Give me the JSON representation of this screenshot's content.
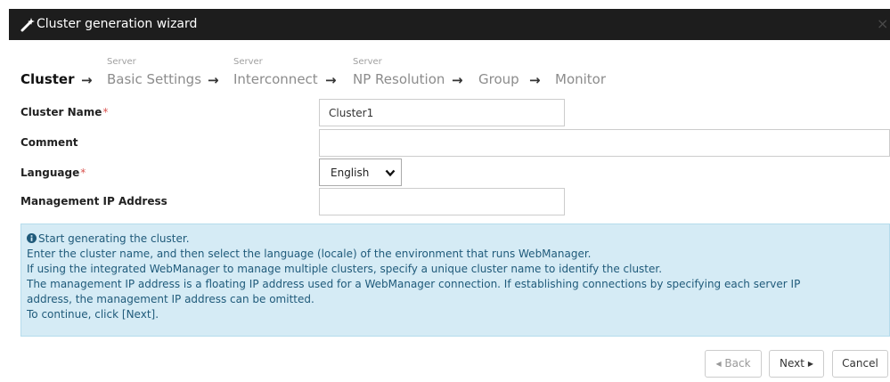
{
  "window": {
    "title": "Cluster generation wizard",
    "close_glyph": "×",
    "icon": "wand-icon"
  },
  "steps": [
    {
      "sub": "",
      "label": "Cluster",
      "active": true
    },
    {
      "sub": "Server",
      "label": "Basic Settings"
    },
    {
      "sub": "Server",
      "label": "Interconnect"
    },
    {
      "sub": "Server",
      "label": "NP Resolution"
    },
    {
      "sub": "",
      "label": "Group"
    },
    {
      "sub": "",
      "label": "Monitor"
    }
  ],
  "step_arrow": "→",
  "form": {
    "cluster_name": {
      "label": "Cluster Name",
      "required_mark": "*",
      "value": "Cluster1"
    },
    "comment": {
      "label": "Comment",
      "value": ""
    },
    "language": {
      "label": "Language",
      "required_mark": "*",
      "selected": "English"
    },
    "management_ip": {
      "label": "Management IP Address",
      "value": ""
    }
  },
  "info": {
    "lines": [
      "Start generating the cluster.",
      "Enter the cluster name, and then select the language (locale) of the environment that runs WebManager.",
      "If using the integrated WebManager to manage multiple clusters, specify a unique cluster name to identify the cluster.",
      "The management IP address is a floating IP address used for a WebManager connection. If establishing connections by specifying each server IP",
      "address, the management IP address can be omitted.",
      "To continue, click [Next]."
    ]
  },
  "buttons": {
    "back": "Back",
    "next": "Next",
    "cancel": "Cancel",
    "back_glyph": "◀",
    "next_glyph": "▶"
  },
  "colors": {
    "titlebar": "#1d1d1d",
    "required": "#d9534f",
    "info_bg": "#d5ebf5",
    "info_text": "#1f5a7a"
  }
}
